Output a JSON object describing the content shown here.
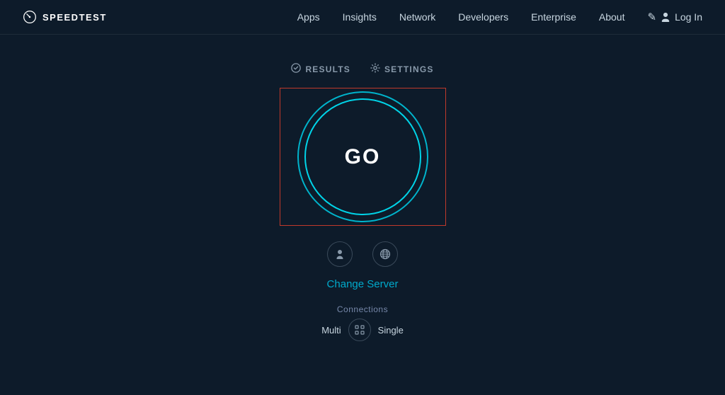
{
  "header": {
    "logo_text": "SPEEDTEST",
    "nav": {
      "items": [
        {
          "label": "Apps",
          "id": "apps"
        },
        {
          "label": "Insights",
          "id": "insights"
        },
        {
          "label": "Network",
          "id": "network"
        },
        {
          "label": "Developers",
          "id": "developers"
        },
        {
          "label": "Enterprise",
          "id": "enterprise"
        },
        {
          "label": "About",
          "id": "about"
        }
      ],
      "login_label": "Log In"
    }
  },
  "tabs": {
    "results_label": "RESULTS",
    "settings_label": "SETTINGS"
  },
  "go_button": {
    "label": "GO"
  },
  "change_server": {
    "label": "Change Server"
  },
  "connections": {
    "label": "Connections",
    "multi_label": "Multi",
    "single_label": "Single"
  },
  "icons": {
    "person_icon": "👤",
    "globe_icon": "🌐",
    "grid_icon": "⊞"
  },
  "colors": {
    "accent_cyan": "#00b4cc",
    "accent_red": "#c0392b",
    "bg_dark": "#0d1b2a"
  }
}
